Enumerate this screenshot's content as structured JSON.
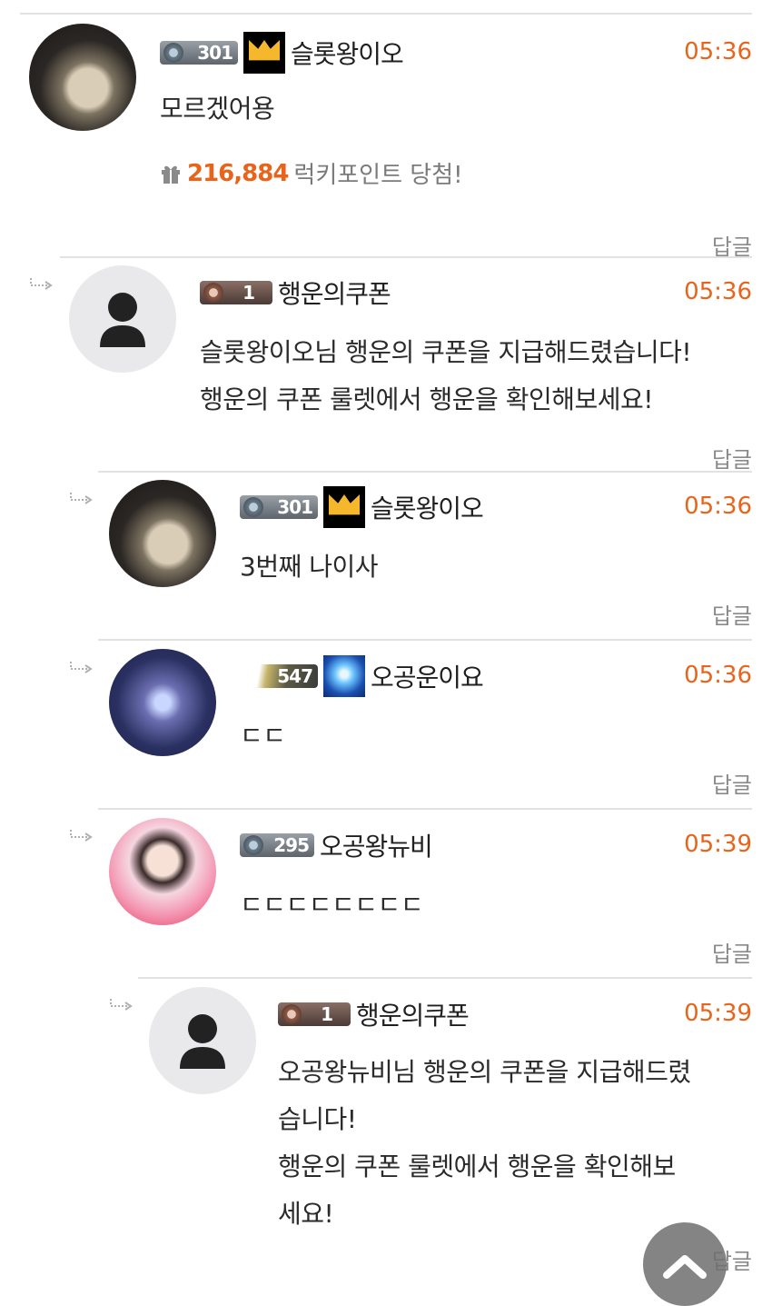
{
  "comments": [
    {
      "level": "301",
      "nickname": "슬롯왕이오",
      "time": "05:36",
      "text": "모르겠어용",
      "lucky_points": "216,884",
      "lucky_label": "럭키포인트 당첨!",
      "reply_label": "답글"
    },
    {
      "level": "1",
      "nickname": "행운의쿠폰",
      "time": "05:36",
      "text_lines": [
        "슬롯왕이오님 행운의 쿠폰을 지급해드렸습니다!",
        "행운의 쿠폰 룰렛에서 행운을 확인해보세요!"
      ],
      "reply_label": "답글"
    },
    {
      "level": "301",
      "nickname": "슬롯왕이오",
      "time": "05:36",
      "text": "3번째 나이사",
      "reply_label": "답글"
    },
    {
      "level": "547",
      "nickname": "오공운이요",
      "time": "05:36",
      "text": "ㄷㄷ",
      "reply_label": "답글"
    },
    {
      "level": "295",
      "nickname": "오공왕뉴비",
      "time": "05:39",
      "text": "ㄷㄷㄷㄷㄷㄷㄷㄷ",
      "reply_label": "답글"
    },
    {
      "level": "1",
      "nickname": "행운의쿠폰",
      "time": "05:39",
      "text_lines": [
        "오공왕뉴비님 행운의 쿠폰을 지급해드렸",
        "습니다!",
        "행운의 쿠폰 룰렛에서 행운을 확인해보",
        "세요!"
      ],
      "reply_label": "답글"
    }
  ],
  "icons": {
    "reply_arrow": "reply-arrow-icon",
    "gift": "gift-icon",
    "crown": "crown-icon",
    "default_avatar": "user-icon",
    "scroll_top": "chevron-up-icon"
  },
  "colors": {
    "accent": "#e8641b",
    "crown": "#f5b82c",
    "divider": "#e2e2e2"
  }
}
